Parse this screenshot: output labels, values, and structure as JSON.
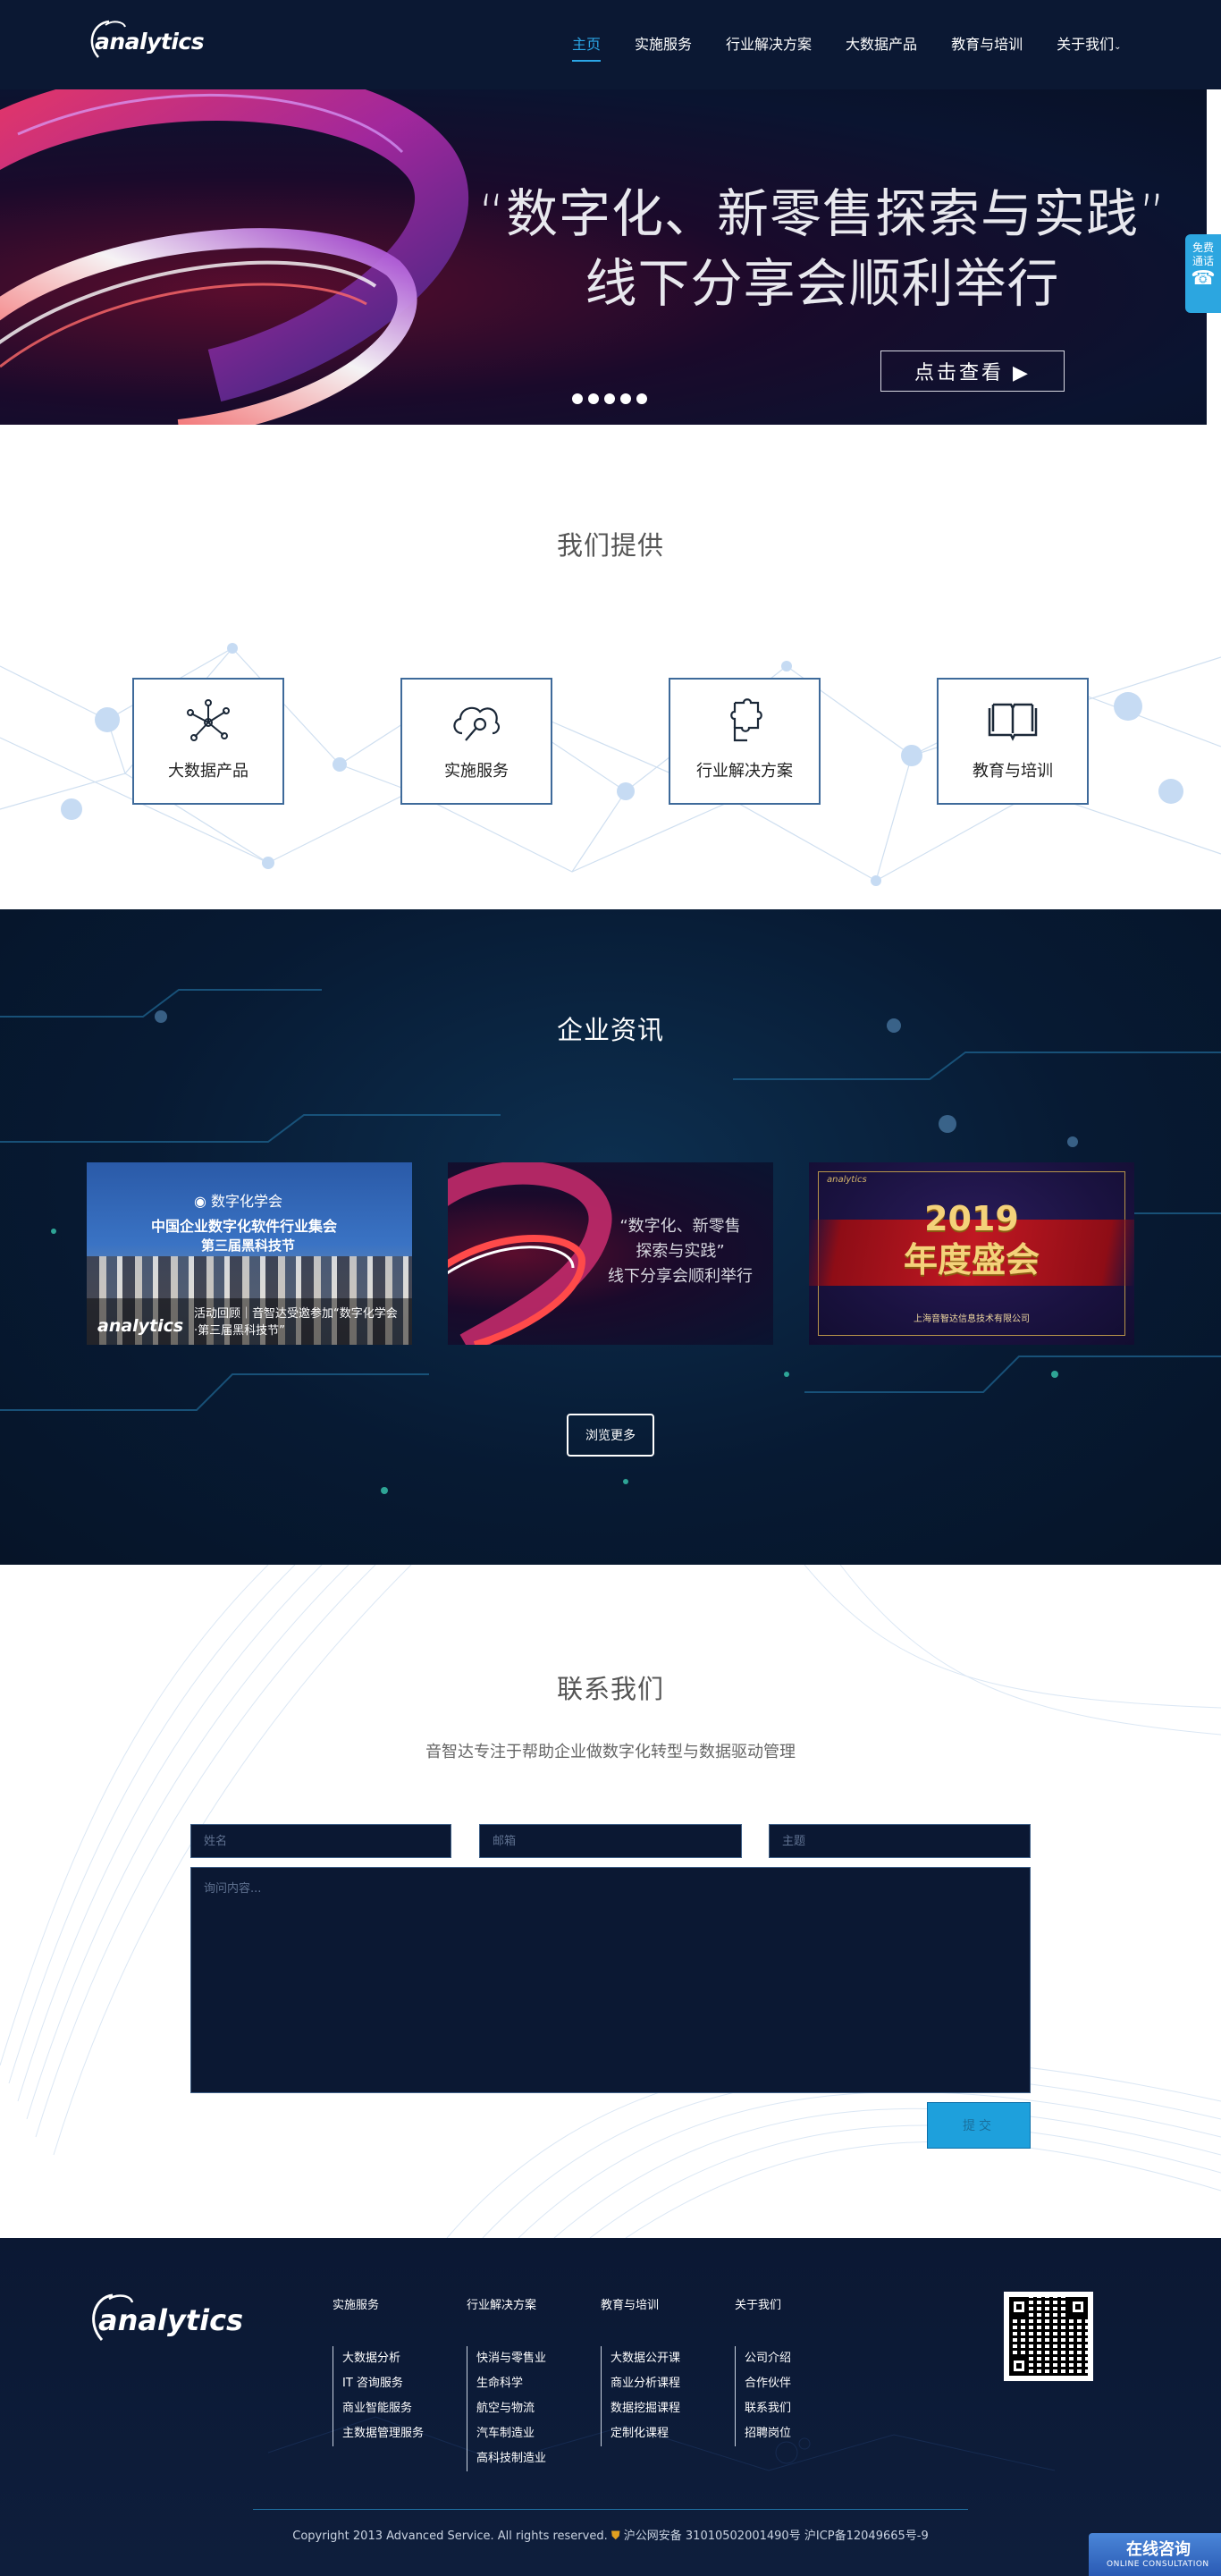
{
  "header": {
    "logo": "analytics",
    "nav": [
      {
        "label": "主页",
        "active": true
      },
      {
        "label": "实施服务"
      },
      {
        "label": "行业解决方案"
      },
      {
        "label": "大数据产品"
      },
      {
        "label": "教育与培训"
      },
      {
        "label": "关于我们"
      }
    ]
  },
  "banner": {
    "line1": "“数字化、新零售探索与实践”",
    "line2": "线下分享会顺利举行",
    "button": "点击查看 ▶",
    "slide_count": 5
  },
  "side_call": {
    "line1": "免费",
    "line2": "通话",
    "icon": "phone-icon"
  },
  "offer": {
    "title": "我们提供",
    "cards": [
      {
        "label": "大数据产品",
        "icon": "network-nodes-icon"
      },
      {
        "label": "实施服务",
        "icon": "cloud-settings-icon"
      },
      {
        "label": "行业解决方案",
        "icon": "puzzle-icon"
      },
      {
        "label": "教育与培训",
        "icon": "open-book-icon"
      }
    ]
  },
  "news": {
    "title": "企业资讯",
    "card1": {
      "org": "数字化学会",
      "headline1": "中国企业数字化软件行业集会",
      "headline2": "第三届黑科技节",
      "logo": "analytics",
      "caption_line1": "活动回顾｜音智达受邀参加“数字化学会",
      "caption_line2": "·第三届黑科技节”"
    },
    "card2": {
      "line1": "“数字化、新零售",
      "line2": "探索与实践”",
      "line3": "线下分享会顺利举行"
    },
    "card3": {
      "brand": "analytics",
      "title1": "2019",
      "title2": "年度盛会",
      "company": "上海音智达信息技术有限公司"
    },
    "more": "浏览更多"
  },
  "contact": {
    "title": "联系我们",
    "subtitle": "音智达专注于帮助企业做数字化转型与数据驱动管理",
    "name_placeholder": "姓名",
    "email_placeholder": "邮箱",
    "subject_placeholder": "主题",
    "message_placeholder": "询问内容...",
    "submit": "提交"
  },
  "footer": {
    "logo": "analytics",
    "columns": [
      {
        "heading": "实施服务",
        "items": [
          "大数据分析",
          "IT 咨询服务",
          "商业智能服务",
          "主数据管理服务"
        ]
      },
      {
        "heading": "行业解决方案",
        "items": [
          "快消与零售业",
          "生命科学",
          "航空与物流",
          "汽车制造业",
          "高科技制造业"
        ]
      },
      {
        "heading": "教育与培训",
        "items": [
          "大数据公开课",
          "商业分析课程",
          "数据挖掘课程",
          "定制化课程"
        ]
      },
      {
        "heading": "关于我们",
        "items": [
          "公司介绍",
          "合作伙伴",
          "联系我们",
          "招聘岗位"
        ]
      }
    ],
    "copyright": "Copyright 2013 Advanced Service. All rights reserved.",
    "beian1": "沪公网安备 31010502001490号",
    "beian2": "沪ICP备12049665号-9",
    "online_cn": "在线咨询",
    "online_en": "ONLINE CONSULTATION"
  }
}
